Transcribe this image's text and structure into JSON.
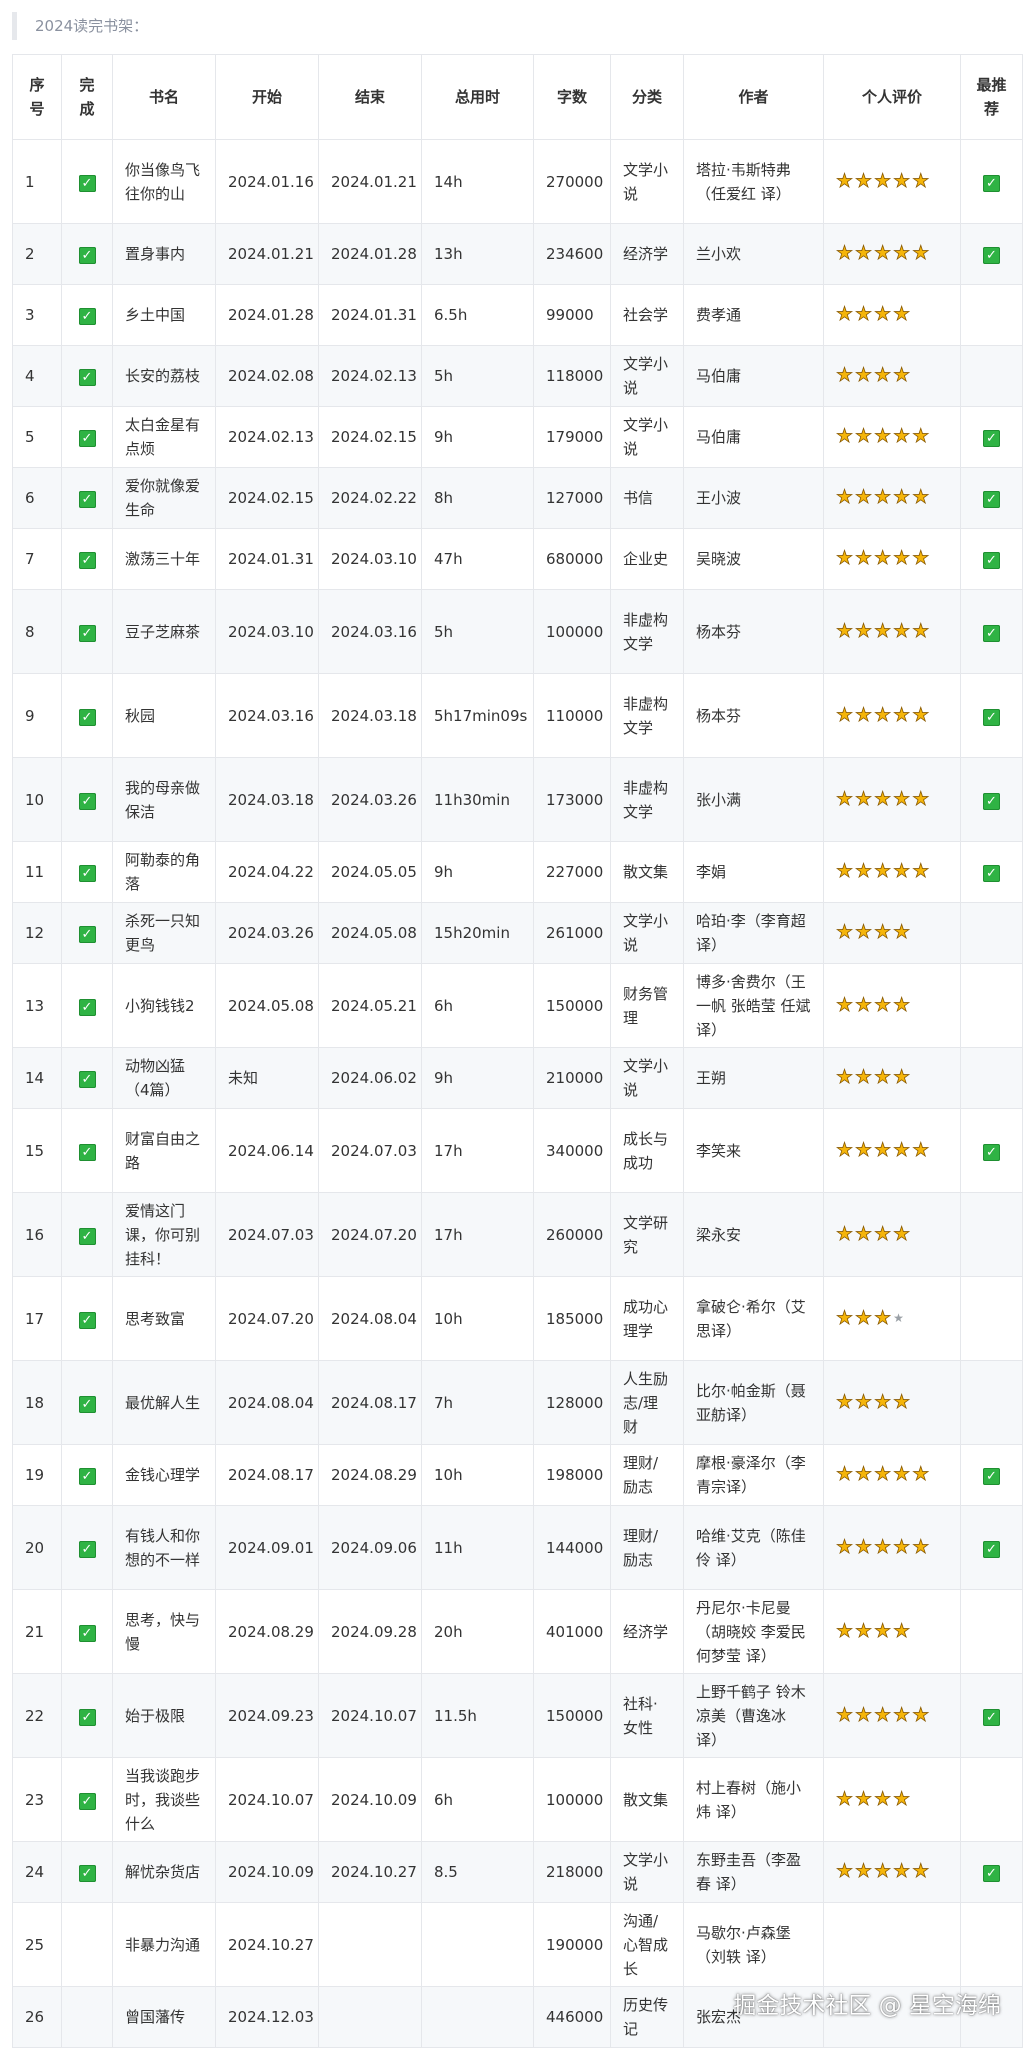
{
  "caption": "2024读完书架：",
  "columns": [
    "序号",
    "完成",
    "书名",
    "开始",
    "结束",
    "总用时",
    "字数",
    "分类",
    "作者",
    "个人评价",
    "最推荐"
  ],
  "rows": [
    {
      "no": "1",
      "done": true,
      "title": "你当像鸟飞往你的山",
      "start": "2024.01.16",
      "end": "2024.01.21",
      "time": "14h",
      "words": "270000",
      "category": "文学小说",
      "author": "塔拉·韦斯特弗（任爱红 译）",
      "stars": 5,
      "rec": true
    },
    {
      "no": "2",
      "done": true,
      "title": "置身事内",
      "start": "2024.01.21",
      "end": "2024.01.28",
      "time": "13h",
      "words": "234600",
      "category": "经济学",
      "author": "兰小欢",
      "stars": 5,
      "rec": true
    },
    {
      "no": "3",
      "done": true,
      "title": "乡土中国",
      "start": "2024.01.28",
      "end": "2024.01.31",
      "time": "6.5h",
      "words": "99000",
      "category": "社会学",
      "author": "费孝通",
      "stars": 4,
      "rec": false
    },
    {
      "no": "4",
      "done": true,
      "title": "长安的荔枝",
      "start": "2024.02.08",
      "end": "2024.02.13",
      "time": "5h",
      "words": "118000",
      "category": "文学小说",
      "author": "马伯庸",
      "stars": 4,
      "rec": false
    },
    {
      "no": "5",
      "done": true,
      "title": "太白金星有点烦",
      "start": "2024.02.13",
      "end": "2024.02.15",
      "time": "9h",
      "words": "179000",
      "category": "文学小说",
      "author": "马伯庸",
      "stars": 5,
      "rec": true
    },
    {
      "no": "6",
      "done": true,
      "title": "爱你就像爱生命",
      "start": "2024.02.15",
      "end": "2024.02.22",
      "time": "8h",
      "words": "127000",
      "category": "书信",
      "author": "王小波",
      "stars": 5,
      "rec": true
    },
    {
      "no": "7",
      "done": true,
      "title": "激荡三十年",
      "start": "2024.01.31",
      "end": "2024.03.10",
      "time": "47h",
      "words": "680000",
      "category": "企业史",
      "author": "吴晓波",
      "stars": 5,
      "rec": true
    },
    {
      "no": "8",
      "done": true,
      "title": "豆子芝麻茶",
      "start": "2024.03.10",
      "end": "2024.03.16",
      "time": "5h",
      "words": "100000",
      "category": "非虚构文学",
      "author": "杨本芬",
      "stars": 5,
      "rec": true
    },
    {
      "no": "9",
      "done": true,
      "title": "秋园",
      "start": "2024.03.16",
      "end": "2024.03.18",
      "time": "5h17min09s",
      "words": "110000",
      "category": "非虚构文学",
      "author": "杨本芬",
      "stars": 5,
      "rec": true
    },
    {
      "no": "10",
      "done": true,
      "title": "我的母亲做保洁",
      "start": "2024.03.18",
      "end": "2024.03.26",
      "time": "11h30min",
      "words": "173000",
      "category": "非虚构文学",
      "author": "张小满",
      "stars": 5,
      "rec": true
    },
    {
      "no": "11",
      "done": true,
      "title": "阿勒泰的角落",
      "start": "2024.04.22",
      "end": "2024.05.05",
      "time": "9h",
      "words": "227000",
      "category": "散文集",
      "author": "李娟",
      "stars": 5,
      "rec": true
    },
    {
      "no": "12",
      "done": true,
      "title": "杀死一只知更鸟",
      "start": "2024.03.26",
      "end": "2024.05.08",
      "time": "15h20min",
      "words": "261000",
      "category": "文学小说",
      "author": "哈珀·李（李育超译）",
      "stars": 4,
      "rec": false
    },
    {
      "no": "13",
      "done": true,
      "title": "小狗钱钱2",
      "start": "2024.05.08",
      "end": "2024.05.21",
      "time": "6h",
      "words": "150000",
      "category": "财务管理",
      "author": "博多·舍费尔（王一帆 张皓莹 任斌译）",
      "stars": 4,
      "rec": false
    },
    {
      "no": "14",
      "done": true,
      "title": "动物凶猛（4篇）",
      "start": "未知",
      "end": "2024.06.02",
      "time": "9h",
      "words": "210000",
      "category": "文学小说",
      "author": "王朔",
      "stars": 4,
      "rec": false
    },
    {
      "no": "15",
      "done": true,
      "title": "财富自由之路",
      "start": "2024.06.14",
      "end": "2024.07.03",
      "time": "17h",
      "words": "340000",
      "category": "成长与成功",
      "author": "李笑来",
      "stars": 5,
      "rec": true
    },
    {
      "no": "16",
      "done": true,
      "title": "爱情这门课，你可别挂科！",
      "start": "2024.07.03",
      "end": "2024.07.20",
      "time": "17h",
      "words": "260000",
      "category": "文学研究",
      "author": "梁永安",
      "stars": 4,
      "rec": false
    },
    {
      "no": "17",
      "done": true,
      "title": "思考致富",
      "start": "2024.07.20",
      "end": "2024.08.04",
      "time": "10h",
      "words": "185000",
      "category": "成功心理学",
      "author": "拿破仑·希尔（艾思译）",
      "stars": 3.5,
      "rec": false
    },
    {
      "no": "18",
      "done": true,
      "title": "最优解人生",
      "start": "2024.08.04",
      "end": "2024.08.17",
      "time": "7h",
      "words": "128000",
      "category": "人生励志/理财",
      "author": "比尔·帕金斯（聂亚舫译）",
      "stars": 4,
      "rec": false
    },
    {
      "no": "19",
      "done": true,
      "title": "金钱心理学",
      "start": "2024.08.17",
      "end": "2024.08.29",
      "time": "10h",
      "words": "198000",
      "category": "理财/励志",
      "author": "摩根·豪泽尔（李青宗译）",
      "stars": 5,
      "rec": true
    },
    {
      "no": "20",
      "done": true,
      "title": "有钱人和你想的不一样",
      "start": "2024.09.01",
      "end": "2024.09.06",
      "time": "11h",
      "words": "144000",
      "category": "理财/励志",
      "author": "哈维·艾克（陈佳伶 译）",
      "stars": 5,
      "rec": true
    },
    {
      "no": "21",
      "done": true,
      "title": "思考，快与慢",
      "start": "2024.08.29",
      "end": "2024.09.28",
      "time": "20h",
      "words": "401000",
      "category": "经济学",
      "author": "丹尼尔·卡尼曼（胡晓姣 李爱民 何梦莹 译）",
      "stars": 4,
      "rec": false
    },
    {
      "no": "22",
      "done": true,
      "title": "始于极限",
      "start": "2024.09.23",
      "end": "2024.10.07",
      "time": "11.5h",
      "words": "150000",
      "category": "社科·女性",
      "author": "上野千鹤子 铃木凉美（曹逸冰 译）",
      "stars": 5,
      "rec": true
    },
    {
      "no": "23",
      "done": true,
      "title": "当我谈跑步时，我谈些什么",
      "start": "2024.10.07",
      "end": "2024.10.09",
      "time": "6h",
      "words": "100000",
      "category": "散文集",
      "author": "村上春树（施小炜 译）",
      "stars": 4,
      "rec": false
    },
    {
      "no": "24",
      "done": true,
      "title": "解忧杂货店",
      "start": "2024.10.09",
      "end": "2024.10.27",
      "time": "8.5",
      "words": "218000",
      "category": "文学小说",
      "author": "东野圭吾（李盈春 译）",
      "stars": 5,
      "rec": true
    },
    {
      "no": "25",
      "done": false,
      "title": "非暴力沟通",
      "start": "2024.10.27",
      "end": "",
      "time": "",
      "words": "190000",
      "category": "沟通/心智成长",
      "author": "马歇尔·卢森堡（刘轶 译）",
      "stars": 0,
      "rec": false
    },
    {
      "no": "26",
      "done": false,
      "title": "曾国藩传",
      "start": "2024.12.03",
      "end": "",
      "time": "",
      "words": "446000",
      "category": "历史传记",
      "author": "张宏杰",
      "stars": 0,
      "rec": false
    }
  ],
  "watermark": "掘金技术社区 @ 星空海绵",
  "colors": {
    "check": "#2fb344",
    "star": "#f5b50a",
    "stripe": "#f6f8fa",
    "border": "#e5e7eb"
  },
  "icons": {
    "done": "check-icon",
    "star": "star-icon"
  }
}
